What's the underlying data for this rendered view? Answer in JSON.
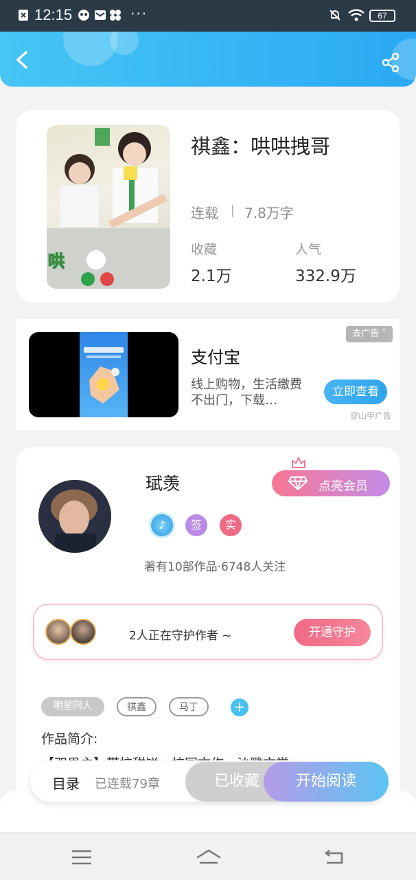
{
  "status_bar": {
    "time": "12:15",
    "extra": "···",
    "battery": "67"
  },
  "book": {
    "title": "祺鑫：哄哄拽哥",
    "status": "连载",
    "word_count": "7.8万字",
    "favorites_label": "收藏",
    "favorites_value": "2.1万",
    "popularity_label": "人气",
    "popularity_value": "332.9万"
  },
  "ad": {
    "remove_label": "去广告 ˅",
    "title": "支付宝",
    "description": "线上购物，生活缴费不出门，下载…",
    "cta": "立即查看",
    "source": "穿山甲广告"
  },
  "author": {
    "name": "珷羡",
    "vip_button": "点亮会员",
    "badges": [
      "签",
      "实"
    ],
    "works_info": "著有10部作品·6748人关注",
    "guard_text": "2人正在守护作者 ~",
    "guard_button": "开通守护"
  },
  "tags": {
    "items": [
      "明星同人",
      "祺鑫",
      "马丁"
    ],
    "add": "+"
  },
  "intro": {
    "label": "作品简介:",
    "preview": "【双男主】带校甜饼，校园文作，沙雕文学"
  },
  "action_bar": {
    "toc": "目录",
    "chapters": "已连载79章",
    "saved": "已收藏",
    "read": "开始阅读"
  },
  "icons": {
    "back": "chevron-left",
    "share": "share",
    "crown": "crown",
    "diamond": "diamond",
    "menu": "menu",
    "home": "home",
    "return": "return"
  },
  "colors": {
    "header": "#2aa9f3",
    "accent_pink": "#f06a85",
    "accent_blue": "#45c0ef"
  }
}
